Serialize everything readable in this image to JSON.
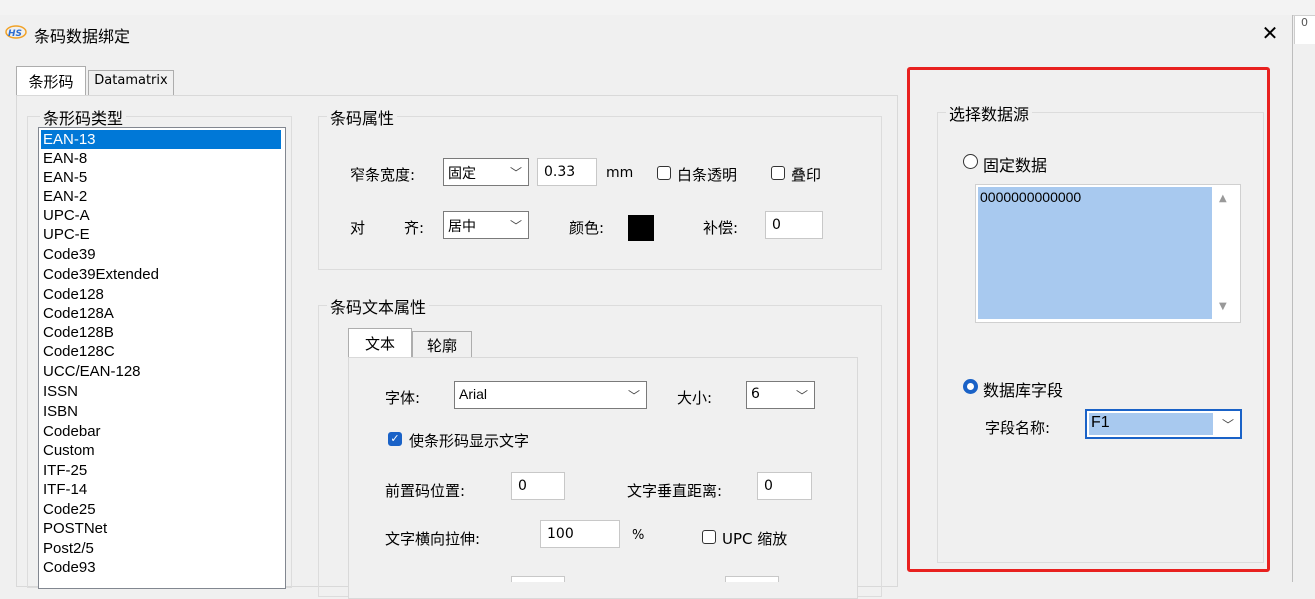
{
  "window": {
    "title": "条码数据绑定",
    "close_glyph": "✕"
  },
  "tabs": [
    {
      "label": "条形码"
    },
    {
      "label": "Datamatrix"
    }
  ],
  "barcode_type": {
    "legend": "条形码类型",
    "items": [
      "EAN-13",
      "EAN-8",
      "EAN-5",
      "EAN-2",
      "UPC-A",
      "UPC-E",
      "Code39",
      "Code39Extended",
      "Code128",
      "Code128A",
      "Code128B",
      "Code128C",
      "UCC/EAN-128",
      "ISSN",
      "ISBN",
      "Codebar",
      "Custom",
      "ITF-25",
      "ITF-14",
      "Code25",
      "POSTNet",
      "Post2/5",
      "Code93"
    ],
    "selected": "EAN-13"
  },
  "barcode_props": {
    "legend": "条码属性",
    "width_label": "窄条宽度:",
    "width_mode": "固定",
    "width_value": "0.33",
    "width_unit": "mm",
    "transparent_label": "白条透明",
    "overprint_label": "叠印",
    "align_label_1": "对",
    "align_label_2": "齐:",
    "align_value": "居中",
    "color_label": "颜色:",
    "color_value": "#000000",
    "compensate_label": "补偿:",
    "compensate_value": "0"
  },
  "text_props": {
    "legend": "条码文本属性",
    "tabs": [
      {
        "label": "文本"
      },
      {
        "label": "轮廓"
      }
    ],
    "font_label": "字体:",
    "font_value": "Arial",
    "size_label": "大小:",
    "size_value": "6",
    "show_text_label": "使条形码显示文字",
    "show_text_checked": true,
    "prefix_pos_label": "前置码位置:",
    "prefix_pos_value": "0",
    "vertical_dist_label": "文字垂直距离:",
    "vertical_dist_value": "0",
    "stretch_label": "文字横向拉伸:",
    "stretch_value": "100",
    "stretch_unit": "%",
    "upc_scale_label": "UPC 缩放"
  },
  "data_source": {
    "legend": "选择数据源",
    "fixed_label": "固定数据",
    "fixed_value": "0000000000000",
    "db_label": "数据库字段",
    "field_name_label": "字段名称:",
    "field_name_value": "F1",
    "selected_option": "数据库字段"
  },
  "accent_color": "#1a62c7",
  "highlight_border_color": "#e8211f"
}
